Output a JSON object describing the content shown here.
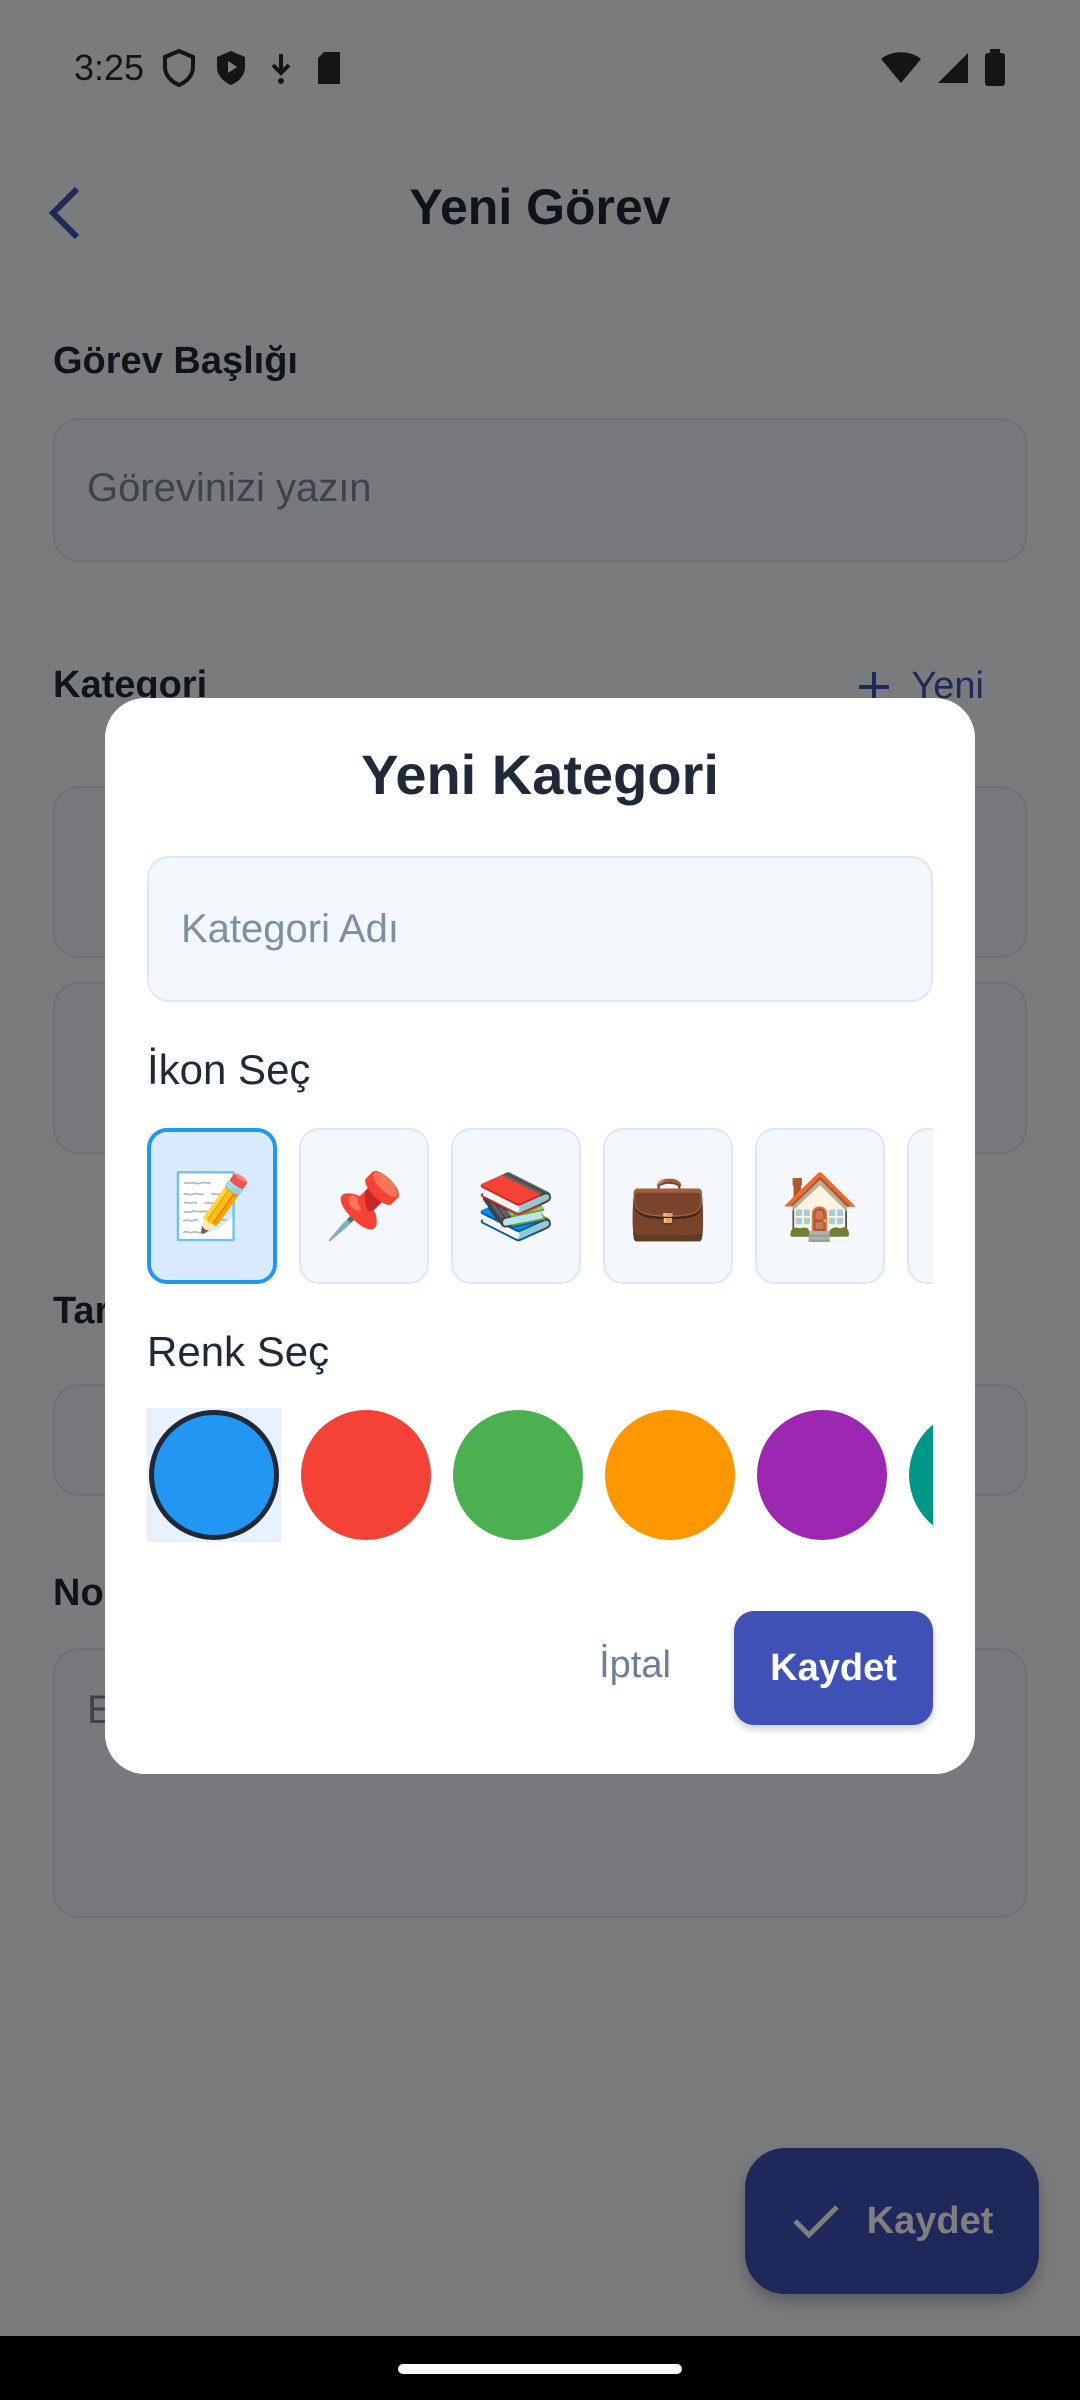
{
  "status_bar": {
    "time": "3:25"
  },
  "app_bar": {
    "title": "Yeni Görev"
  },
  "form": {
    "task_title_label": "Görev Başlığı",
    "task_title_placeholder": "Görevinizi yazın",
    "category_label": "Kategori",
    "new_category_link": "Yeni",
    "date_label": "Tar",
    "notes_label": "No",
    "notes_placeholder": "E"
  },
  "fab": {
    "label": "Kaydet"
  },
  "dialog": {
    "title": "Yeni Kategori",
    "name_placeholder": "Kategori Adı",
    "icon_label": "İkon Seç",
    "icons": [
      "📝",
      "📌",
      "📚",
      "💼",
      "🏠",
      ""
    ],
    "selected_icon_index": 0,
    "color_label": "Renk Seç",
    "colors": [
      "#2196F3",
      "#F44336",
      "#4CAF50",
      "#FF9800",
      "#9C27B0",
      "#009688"
    ],
    "selected_color_index": 0,
    "cancel_label": "İptal",
    "save_label": "Kaydet"
  }
}
